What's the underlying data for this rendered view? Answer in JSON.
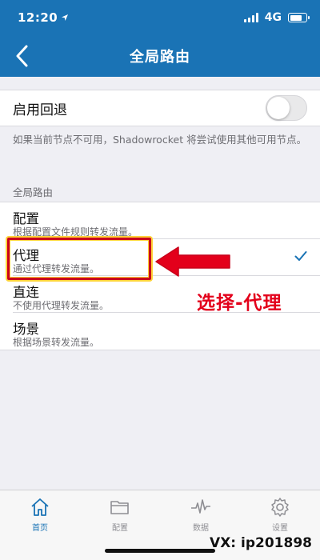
{
  "status_bar": {
    "time": "12:20",
    "network": "4G",
    "battery_level": 0.75
  },
  "nav": {
    "title": "全局路由",
    "back_icon": "chevron-left-icon"
  },
  "fallback": {
    "label": "启用回退",
    "enabled": false,
    "footnote": "如果当前节点不可用，Shadowrocket 将尝试使用其他可用节点。"
  },
  "routes": {
    "header": "全局路由",
    "items": [
      {
        "title": "配置",
        "subtitle": "根据配置文件规则转发流量。",
        "selected": false
      },
      {
        "title": "代理",
        "subtitle": "通过代理转发流量。",
        "selected": true
      },
      {
        "title": "直连",
        "subtitle": "不使用代理转发流量。",
        "selected": false
      },
      {
        "title": "场景",
        "subtitle": "根据场景转发流量。",
        "selected": false
      }
    ]
  },
  "annotation": {
    "text": "选择-代理",
    "color": "#e3001b"
  },
  "tab_bar": {
    "tabs": [
      {
        "label": "首页",
        "icon": "home-icon",
        "active": true
      },
      {
        "label": "配置",
        "icon": "folder-icon",
        "active": false
      },
      {
        "label": "数据",
        "icon": "activity-icon",
        "active": false
      },
      {
        "label": "设置",
        "icon": "gear-icon",
        "active": false
      }
    ]
  },
  "watermark": "VX: ip201898",
  "colors": {
    "accent": "#1a73b5",
    "highlight_border": "#c9001b"
  }
}
